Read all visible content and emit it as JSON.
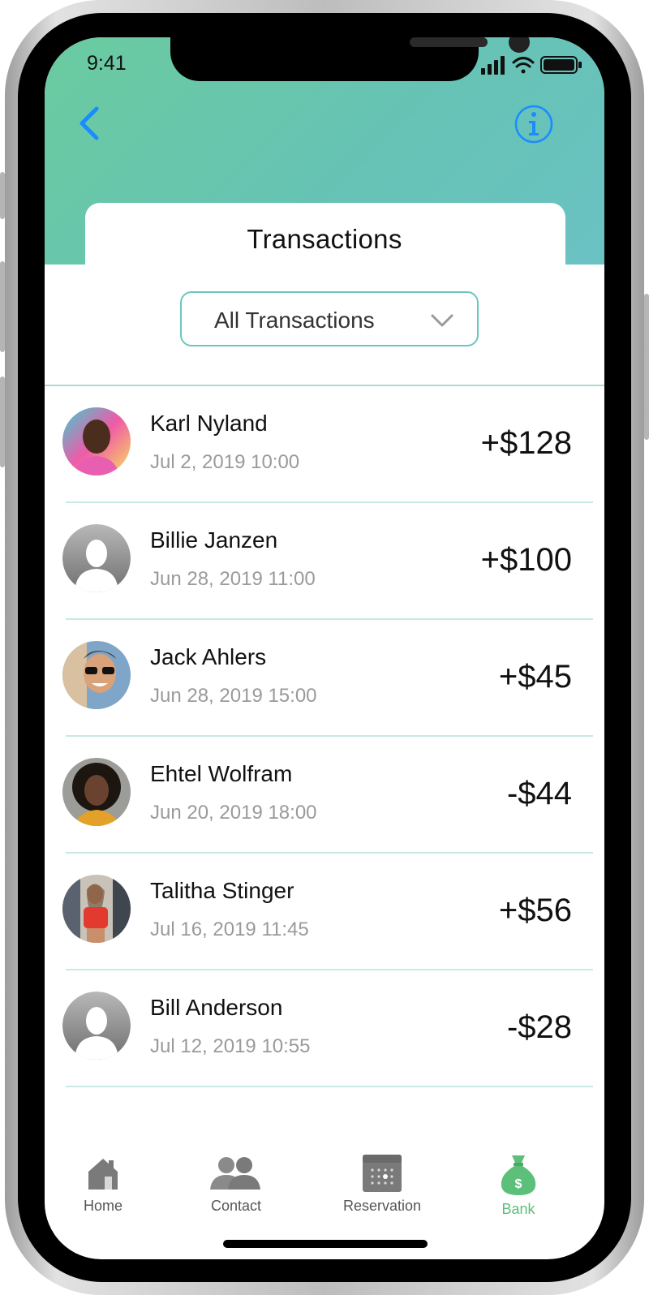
{
  "status_bar": {
    "time": "9:41"
  },
  "header": {
    "title": "Transactions"
  },
  "filter": {
    "selected": "All Transactions"
  },
  "transactions": [
    {
      "name": "Karl Nyland",
      "date": "Jul 2, 2019   10:00",
      "amount": "+$128",
      "avatar": "photo"
    },
    {
      "name": "Billie Janzen",
      "date": "Jun 28, 2019  11:00",
      "amount": "+$100",
      "avatar": "placeholder"
    },
    {
      "name": "Jack Ahlers",
      "date": "Jun 28, 2019   15:00",
      "amount": "+$45",
      "avatar": "photo"
    },
    {
      "name": "Ehtel Wolfram",
      "date": "Jun 20, 2019   18:00",
      "amount": "-$44",
      "avatar": "photo"
    },
    {
      "name": "Talitha Stinger",
      "date": "Jul 16, 2019    11:45",
      "amount": "+$56",
      "avatar": "photo"
    },
    {
      "name": "Bill Anderson",
      "date": "Jul 12, 2019   10:55",
      "amount": "-$28",
      "avatar": "placeholder"
    }
  ],
  "tabbar": {
    "items": [
      {
        "label": "Home",
        "icon": "home-icon"
      },
      {
        "label": "Contact",
        "icon": "contacts-icon"
      },
      {
        "label": "Reservation",
        "icon": "calendar-icon"
      },
      {
        "label": "Bank",
        "icon": "money-bag-icon",
        "active": true
      }
    ]
  },
  "colors": {
    "header_gradient_start": "#6bcb9f",
    "header_gradient_end": "#6ac2c3",
    "accent_blue": "#1a8cff",
    "active_tab": "#5cbf7a",
    "divider": "#c9e9e6"
  }
}
